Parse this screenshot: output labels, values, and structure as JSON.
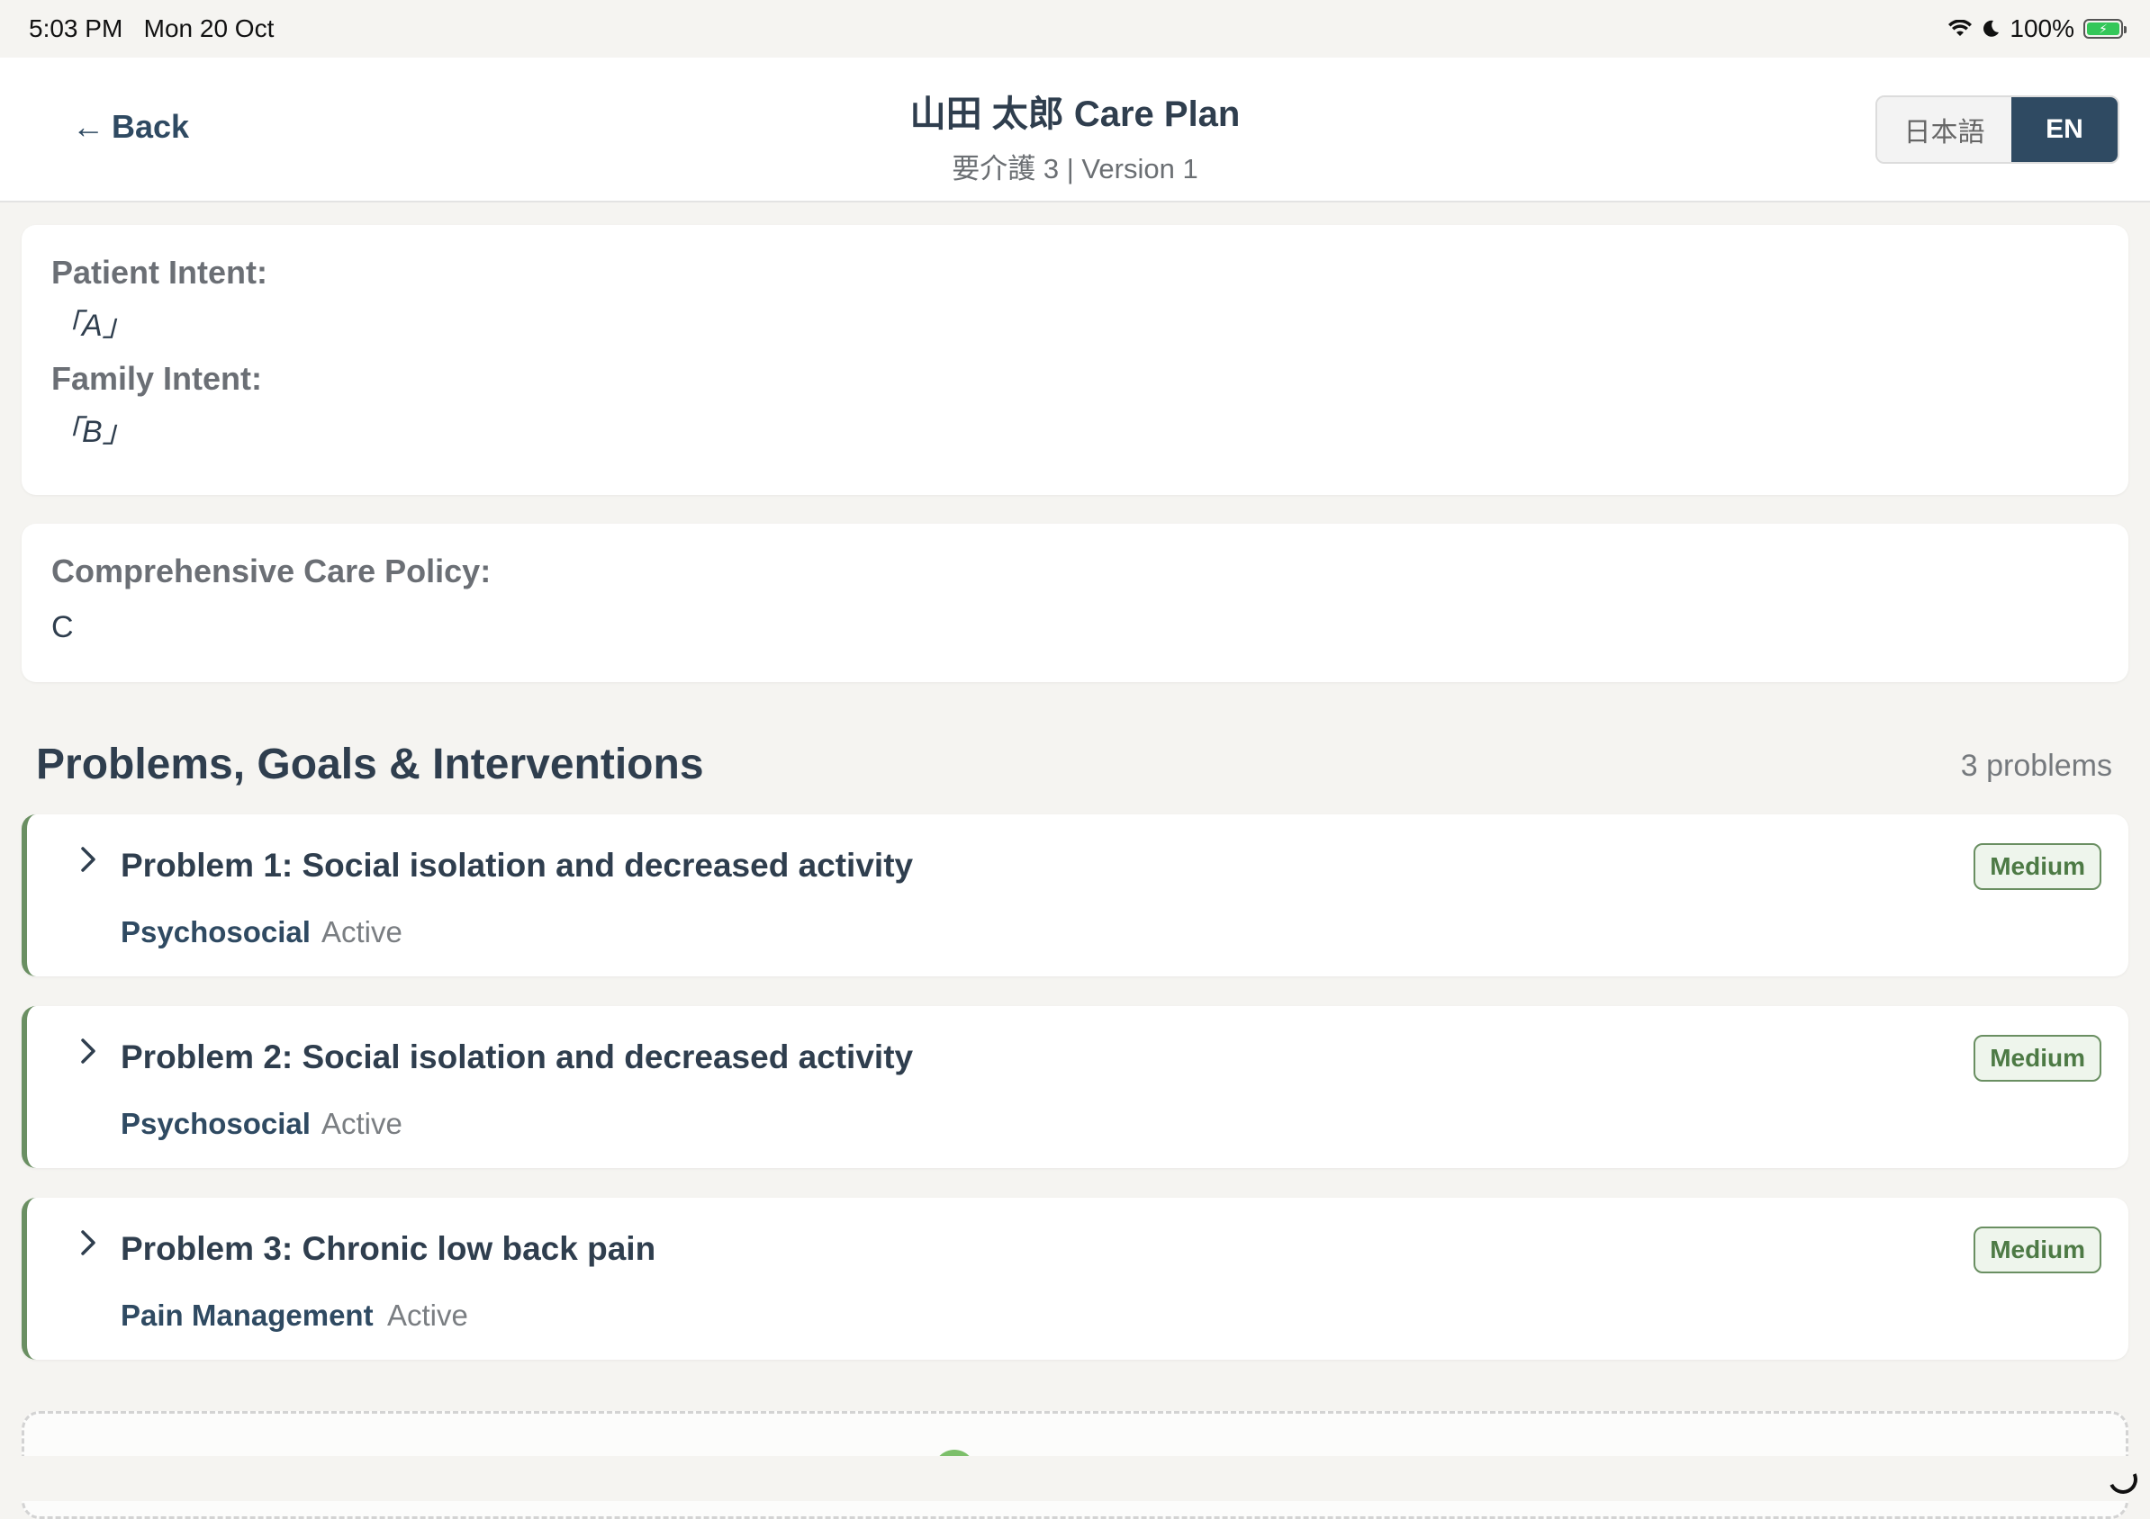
{
  "status_bar": {
    "time": "5:03 PM",
    "date": "Mon 20 Oct",
    "battery": "100%",
    "icons": [
      "wifi-icon",
      "moon-icon",
      "battery-charging-icon"
    ]
  },
  "header": {
    "back_label": "Back",
    "title": "山田 太郎 Care Plan",
    "subtitle": "要介護 3 | Version 1",
    "lang_options": [
      "日本語",
      "EN"
    ],
    "lang_selected": "EN",
    "accent_color": "#2f4a62"
  },
  "intent": {
    "patient_label": "Patient Intent:",
    "patient_value": "「A」",
    "family_label": "Family Intent:",
    "family_value": "「B」"
  },
  "policy": {
    "label": "Comprehensive Care Policy:",
    "value": "C"
  },
  "problems_section": {
    "title": "Problems, Goals & Interventions",
    "count_label": "3 problems",
    "items": [
      {
        "title": "Problem 1: Social isolation and decreased activity",
        "category": "Psychosocial",
        "status": "Active",
        "priority": "Medium"
      },
      {
        "title": "Problem 2: Social isolation and decreased activity",
        "category": "Psychosocial",
        "status": "Active",
        "priority": "Medium"
      },
      {
        "title": "Problem 3: Chronic low back pain",
        "category": "Pain Management",
        "status": "Active",
        "priority": "Medium"
      }
    ],
    "priority_color": "#6a8f62"
  }
}
